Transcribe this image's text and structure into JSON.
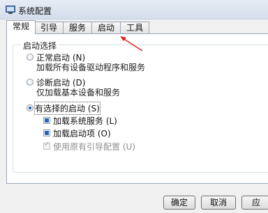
{
  "window": {
    "title": "系统配置"
  },
  "tabs": [
    {
      "label": "常规",
      "active": true
    },
    {
      "label": "引导",
      "active": false
    },
    {
      "label": "服务",
      "active": false
    },
    {
      "label": "启动",
      "active": false
    },
    {
      "label": "工具",
      "active": false
    }
  ],
  "startup_selection": {
    "group_title": "启动选择",
    "options": [
      {
        "label": "正常启动 (N)",
        "description": "加载所有设备驱动程序和服务",
        "checked": false
      },
      {
        "label": "诊断启动 (D)",
        "description": "仅加载基本设备和服务",
        "checked": false
      },
      {
        "label": "有选择的启动 (S)",
        "checked": true
      }
    ],
    "selective_items": [
      {
        "label": "加载系统服务 (L)",
        "state": "indeterminate",
        "enabled": true
      },
      {
        "label": "加载启动项 (O)",
        "state": "indeterminate",
        "enabled": true
      },
      {
        "label": "使用原有引导配置 (U)",
        "state": "checked",
        "enabled": false
      }
    ]
  },
  "buttons": {
    "ok": "确定",
    "cancel": "取消",
    "apply": "应"
  },
  "colors": {
    "accent": "#2a62b8",
    "annotation_arrow": "#e02020"
  }
}
